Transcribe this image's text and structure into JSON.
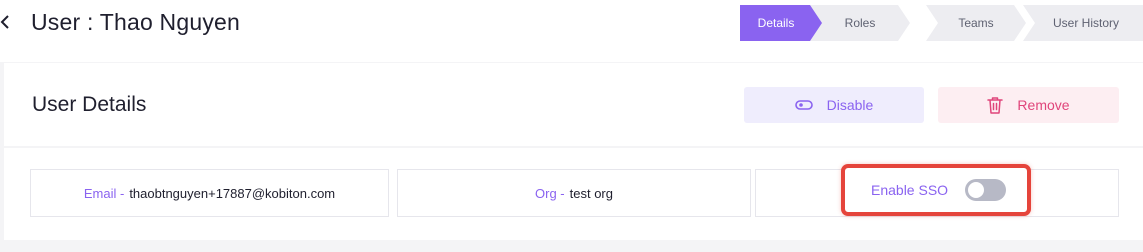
{
  "header": {
    "title": "User : Thao Nguyen",
    "steps": [
      {
        "label": "Details",
        "active": true
      },
      {
        "label": "Roles",
        "active": false
      },
      {
        "label": "Teams",
        "active": false
      },
      {
        "label": "User History",
        "active": false
      }
    ]
  },
  "details": {
    "title": "User Details",
    "disable_label": "Disable",
    "remove_label": "Remove",
    "email_label": "Email -",
    "email_value": "thaobtnguyen+17887@kobiton.com",
    "org_label": "Org -",
    "org_value": "test org",
    "sso_label": "Enable SSO",
    "sso_enabled": false
  },
  "colors": {
    "accent": "#8a63f0",
    "danger": "#e0457b",
    "highlight": "#e5443b"
  },
  "icons": [
    "chevron-left-icon",
    "toggle-icon",
    "trash-icon"
  ]
}
